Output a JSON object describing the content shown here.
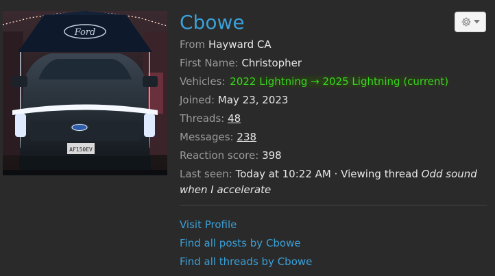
{
  "profile": {
    "username": "Cbowe",
    "from_label": "From",
    "from_value": "Hayward CA",
    "first_name_label": "First Name:",
    "first_name_value": "Christopher",
    "vehicles_label": "Vehicles:",
    "vehicles_value": "2022 Lightning → 2025 Lightning (current)",
    "joined_label": "Joined:",
    "joined_value": "May 23, 2023",
    "threads_label": "Threads:",
    "threads_value": "48",
    "messages_label": "Messages:",
    "messages_value": "238",
    "reaction_label": "Reaction score:",
    "reaction_value": "398",
    "last_seen_label": "Last seen:",
    "last_seen_value": "Today at 10:22 AM · Viewing thread",
    "last_seen_thread": "Odd sound when I accelerate"
  },
  "links": {
    "visit_profile": "Visit Profile",
    "find_posts": "Find all posts by Cbowe",
    "find_threads": "Find all threads by Cbowe"
  },
  "avatar": {
    "tent_text": "Ford",
    "plate_text": "AF150EV"
  },
  "colors": {
    "background": "#2a2a2a",
    "link": "#3aa0d8",
    "vehicles": "#39d423"
  },
  "icons": {
    "menu": "gear-icon",
    "menu_caret": "caret-down-icon"
  }
}
